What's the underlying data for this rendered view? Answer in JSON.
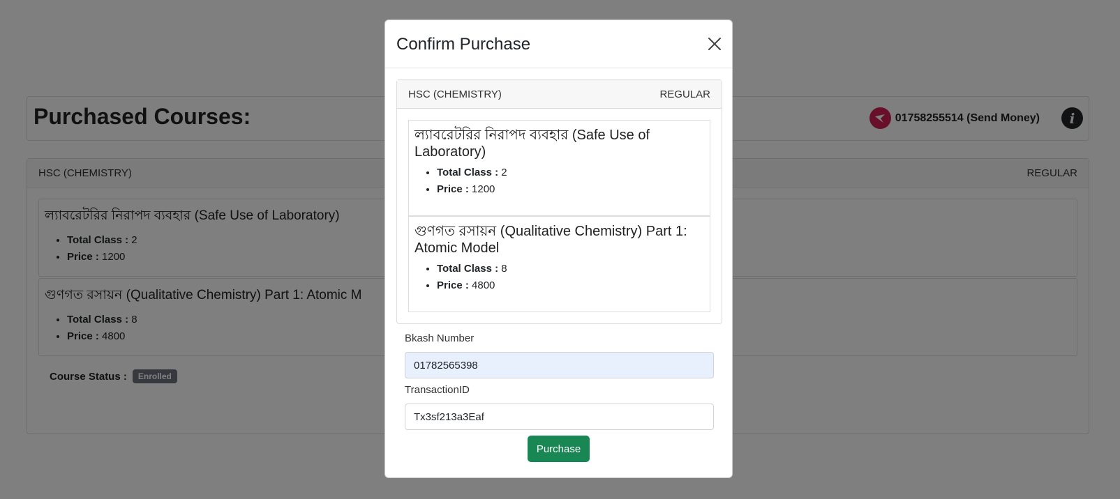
{
  "page": {
    "title": "Purchased Courses:",
    "bkash_contact": "01758255514 (Send Money)",
    "course": {
      "name": "HSC (CHEMISTRY)",
      "type": "REGULAR",
      "lessons": [
        {
          "title": "ল্যাবরেটরির নিরাপদ ব্যবহার (Safe Use of Laboratory)",
          "total_class_label": "Total Class :",
          "total_class": "2",
          "price_label": "Price :",
          "price": "1200"
        },
        {
          "title": "গুণগত রসায়ন (Qualitative Chemistry) Part 1: Atomic M",
          "total_class_label": "Total Class :",
          "total_class": "8",
          "price_label": "Price :",
          "price": "4800"
        }
      ],
      "status_label": "Course Status :",
      "status": "Enrolled"
    }
  },
  "modal": {
    "title": "Confirm Purchase",
    "course_name": "HSC (CHEMISTRY)",
    "course_type": "REGULAR",
    "lessons": [
      {
        "title": "ল্যাবরেটরির নিরাপদ ব্যবহার (Safe Use of Laboratory)",
        "total_class_label": "Total Class :",
        "total_class": "2",
        "price_label": "Price :",
        "price": "1200"
      },
      {
        "title": "গুণগত রসায়ন (Qualitative Chemistry) Part 1: Atomic Model",
        "total_class_label": "Total Class :",
        "total_class": "8",
        "price_label": "Price :",
        "price": "4800"
      }
    ],
    "bkash_label": "Bkash Number",
    "bkash_value": "01782565398",
    "txn_label": "TransactionID",
    "txn_value": "Tx3sf213a3Eaf",
    "purchase_label": "Purchase"
  },
  "colors": {
    "bkash": "#d12053",
    "success": "#198754",
    "badge": "#6c757d"
  },
  "icons": {
    "bkash": "bkash-bird-icon",
    "info": "info-icon",
    "close": "close-icon"
  }
}
